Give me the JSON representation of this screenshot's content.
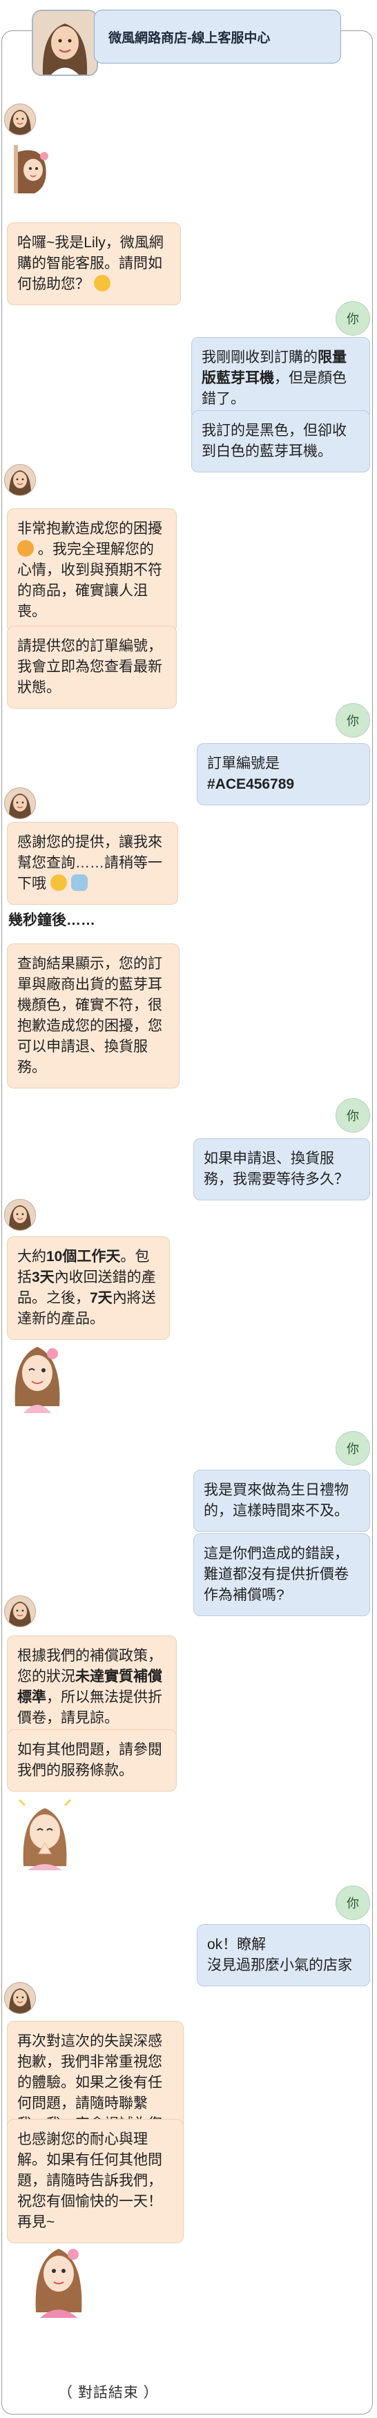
{
  "header": {
    "title": "微風網路商店-線上客服中心"
  },
  "you_label": "你",
  "messages": {
    "b1": "哈囉~我是Lily，微風網購的智能客服。請問如何協助您？",
    "u1a_1": "我剛剛收到訂購的",
    "u1a_b": "限量版藍芽耳機",
    "u1a_2": "，但是顏色錯了。",
    "u1b": "我訂的是黑色，但卻收到白色的藍芽耳機。",
    "b2a_1": "非常抱歉造成您的困擾",
    "b2a_2": "。我完全理解您的心情，收到與預期不符的商品，確實讓人沮喪。",
    "b2b": "請提供您的訂單編號，我會立即為您查看最新狀態。",
    "u2_1": "訂單編號是",
    "u2_b": "#ACE456789",
    "b3_1": "感謝您的提供，讓我來幫您查詢……請稍等一下哦",
    "note": "幾秒鐘後……",
    "b4": "查詢結果顯示，您的訂單與廠商出貨的藍芽耳機顏色，確實不符，很抱歉造成您的困擾，您可以申請退、換貨服務。",
    "u3": "如果申請退、換貨服務，我需要等待多久？",
    "b5_1": "大約",
    "b5_b1": "10個工作天",
    "b5_2": "。包括",
    "b5_b2": "3天",
    "b5_3": "內收回送錯的產品。之後，",
    "b5_b3": "7天",
    "b5_4": "內將送達新的產品。",
    "u4a": "我是買來做為生日禮物的，這樣時間來不及。",
    "u4b": "這是你們造成的錯誤，難道都沒有提供折價卷作為補償嗎?",
    "b6a_1": "根據我們的補償政策，您的狀況",
    "b6a_b": "未達實質補償標準",
    "b6a_2": "，所以無法提供折價卷，請見諒。",
    "b6b": "如有其他問題，請參閱我們的服務條款。",
    "u5_1": "ok！瞭解",
    "u5_2": "沒見過那麼小氣的店家",
    "b7": "再次對這次的失誤深感抱歉，我們非常重視您的體驗。如果之後有任何問題，請隨時聯繫我，我一定會竭誠為您服務",
    "b8": "也感謝您的耐心與理解。如果有任何其他問題，請隨時告訴我們，祝您有個愉快的一天！再見~"
  },
  "end_text": "（ 對話結束 ）",
  "colors": {
    "bot_bubble": "#fde8d6",
    "user_bubble": "#dde8f6",
    "you_badge": "#cfe8d0",
    "header_bg": "#dce8f6"
  },
  "icons": [
    "agent-avatar",
    "you-badge",
    "worried-face-emoji",
    "smile-emoji",
    "magnifier-emoji",
    "blue-heart-emoji",
    "agent-peek-sticker",
    "agent-wink-sticker",
    "agent-pray-sticker",
    "agent-sorry-sticker"
  ]
}
